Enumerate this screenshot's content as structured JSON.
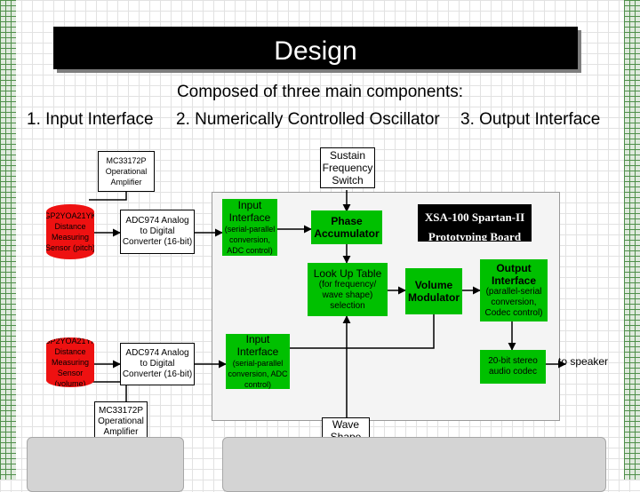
{
  "title": "Design",
  "subtitle": "Composed of three main components:",
  "components": {
    "c1": "1. Input Interface",
    "c2": "2. Numerically Controlled Oscillator",
    "c3": "3. Output Interface"
  },
  "blocks": {
    "mc_top": "MC33172P Operational Amplifier",
    "sensor_pitch": "GP2YOA21YK Distance Measuring Sensor (pitch)",
    "adc_top": "ADC974 Analog to Digital Converter (16-bit)",
    "input_top_title": "Input Interface",
    "input_top_desc": "(serial-parallel conversion, ADC control)",
    "sustain": "Sustain Frequency Switch",
    "phase": "Phase Accumulator",
    "xsa": "XSA-100 Spartan-II",
    "proto": "Prototyping Board",
    "lut_title": "Look Up Table",
    "lut_desc": "(for frequency/ wave shape) selection",
    "volume_mod": "Volume Modulator",
    "output_title": "Output Interface",
    "output_desc": "(parallel-serial conversion, Codec control)",
    "sensor_volume": "GP2YOA21YK Distance Measuring Sensor (volume)",
    "adc_bottom": "ADC974 Analog to Digital Converter (16-bit)",
    "input_bot_title": "Input Interface",
    "input_bot_desc": "(serial-parallel conversion, ADC control)",
    "mc_bottom": "MC33172P Operational Amplifier",
    "codec": "20-bit stereo audio codec",
    "to_speaker": "to speaker",
    "wave": "Wave Shape Selector"
  },
  "colors": {
    "green": "#00c000",
    "red": "#ee1111",
    "black": "#000000",
    "accent": "#4f8f4a"
  }
}
